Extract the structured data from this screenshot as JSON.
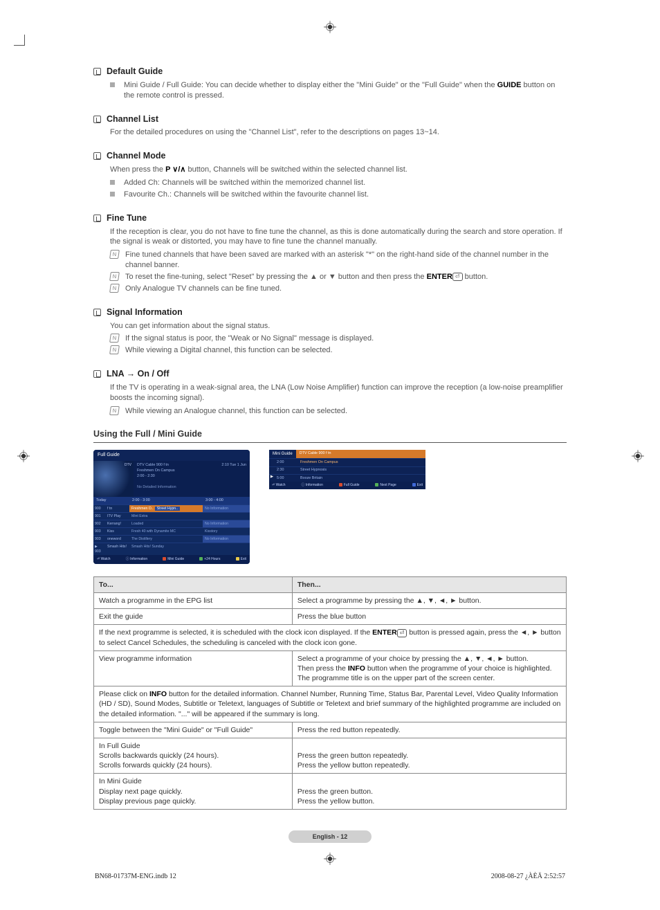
{
  "sections": {
    "default_guide": {
      "title": "Default Guide",
      "bullets": [
        "Mini Guide / Full Guide: You can decide whether to display either the \"Mini Guide\" or the \"Full Guide\" when the GUIDE button on the remote control is pressed."
      ]
    },
    "channel_list": {
      "title": "Channel List",
      "body": "For the detailed procedures on using the \"Channel List\", refer to the descriptions on pages 13~14."
    },
    "channel_mode": {
      "title": "Channel Mode",
      "body_prefix": "When press the ",
      "body_mid": " button, Channels will be switched within the selected channel list.",
      "p_label": "P ∨/∧",
      "bullets": [
        "Added Ch: Channels will be switched within the memorized channel list.",
        "Favourite Ch.: Channels will be switched within the favourite channel list."
      ]
    },
    "fine_tune": {
      "title": "Fine Tune",
      "body": "If the reception is clear, you do not have to fine tune the channel, as this is done automatically during the search and store operation. If the signal is weak or distorted, you may have to fine tune the channel manually.",
      "notes": [
        "Fine tuned channels that have been saved are marked with an asterisk \"*\" on the right-hand side of the channel number in the channel banner.",
        "To reset the fine-tuning, select \"Reset\" by pressing the ▲ or ▼ button and then press the ENTER⏎ button.",
        "Only Analogue TV channels can be fine tuned."
      ]
    },
    "signal_info": {
      "title": "Signal Information",
      "body": "You can get information about the signal status.",
      "notes": [
        "If the signal status is poor, the \"Weak or No Signal\" message is displayed.",
        "While viewing a Digital channel, this function can be selected."
      ]
    },
    "lna": {
      "title": "LNA → On / Off",
      "body": "If the TV is operating in a weak-signal area, the LNA (Low Noise Amplifier) function can improve the reception (a low-noise preamplifier boosts the incoming signal).",
      "notes": [
        "While viewing an Analogue channel, this function can be selected."
      ]
    }
  },
  "subheading": "Using the Full / Mini Guide",
  "full_guide": {
    "title": "Full Guide",
    "channel_label": "DTV Cable 900 f tn",
    "programme": "Freshmen On Campus",
    "time": "2:00 - 2:30",
    "no_detail": "No Detailed Information",
    "date_time": "2:10 Tue 1 Jun",
    "dtv_tag": "DTV",
    "col_today": "Today",
    "col_t1": "2:00 - 3:00",
    "col_t2": "3:00 - 4:00",
    "rows": [
      {
        "num": "900",
        "ch": "f tn",
        "p1": "Freshmen O..",
        "p1b": "Street Hypn..",
        "p2": "No Information",
        "sel": true
      },
      {
        "num": "901",
        "ch": "ITV Play",
        "p1": "Mint Extra",
        "p2": ""
      },
      {
        "num": "902",
        "ch": "Kerrang!",
        "p1": "Loaded",
        "p2": "No Information"
      },
      {
        "num": "903",
        "ch": "Kiss",
        "p1": "Fresh 40 with Dynamite MC",
        "p2": "Kisstory"
      },
      {
        "num": "903",
        "ch": "oneword",
        "p1": "The Distillery",
        "p2": "No Information"
      },
      {
        "num": "903",
        "ch": "Smash Hits!",
        "p1": "Smash Hits! Sunday",
        "p2": ""
      }
    ],
    "foot": {
      "watch": "Watch",
      "info": "Information",
      "red": "Mini Guide",
      "green": "+24 Hours",
      "yellow": "Exit"
    }
  },
  "mini_guide": {
    "title": "Mini Guide",
    "channel_label": "DTV Cable 900 f tn",
    "rows": [
      {
        "time": "2:00",
        "prog": "Freshmen On Campus",
        "sel": true
      },
      {
        "time": "2:30",
        "prog": "Street Hypnosis"
      },
      {
        "time": "5:00",
        "prog": "Booze Britain",
        "play": "▶"
      }
    ],
    "foot": {
      "watch": "Watch",
      "info": "Information",
      "red": "Full Guide",
      "green": "Next Page",
      "blue": "Exit"
    }
  },
  "table_headers": {
    "to": "To...",
    "then": "Then..."
  },
  "table_rows": [
    {
      "to": "Watch a programme in the EPG list",
      "then": "Select a programme by pressing the ▲, ▼, ◄, ► button."
    },
    {
      "to": "Exit the guide",
      "then": "Press the blue button"
    }
  ],
  "note1": "If the next programme is selected, it is scheduled with the clock icon displayed. If the ENTER⏎ button is pressed again, press the ◄, ► button to select Cancel Schedules, the scheduling is canceled with the clock icon gone.",
  "row_view": {
    "to": "View programme information",
    "then": "Select a programme of your choice by pressing the ▲, ▼, ◄, ► button.\nThen press the INFO button when the programme of your choice is highlighted.\nThe programme title is on the upper part of the screen center."
  },
  "note2": "Please click on INFO button for the detailed information. Channel Number, Running Time, Status Bar, Parental Level, Video Quality Information (HD / SD), Sound Modes, Subtitle or Teletext, languages of Subtitle or Teletext and brief summary of the highlighted programme are included on the detailed information. \"...\" will be appeared if the summary is long.",
  "row_toggle": {
    "to": "Toggle between the \"Mini Guide\" or \"Full Guide\"",
    "then": "Press the red button repeatedly."
  },
  "row_full": {
    "to": "In Full Guide\nScrolls backwards quickly (24 hours).\nScrolls forwards quickly (24 hours).",
    "then": "Press the green button repeatedly.\nPress the yellow button repeatedly."
  },
  "row_mini": {
    "to": "In Mini Guide\nDisplay next page quickly.\nDisplay previous page quickly.",
    "then": "Press the green button.\nPress the yellow button."
  },
  "page_badge": "English - 12",
  "footer": {
    "left": "BN68-01737M-ENG.indb   12",
    "right": "2008-08-27   ¿ÀÈÄ 2:52:57"
  }
}
